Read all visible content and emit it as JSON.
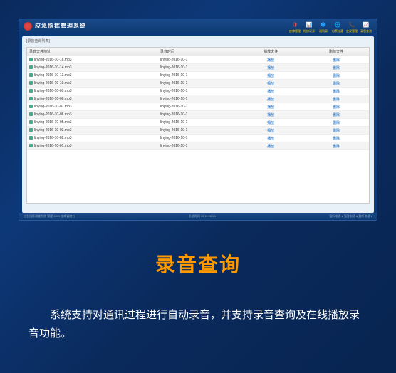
{
  "app": {
    "title": "应急指挥管理系统",
    "breadcrumb": "[录音查询列表]"
  },
  "header_icons": [
    {
      "name": "shield-icon",
      "glyph": "🛡",
      "label": "座席管理",
      "color": "#e55"
    },
    {
      "name": "bars-icon",
      "glyph": "📊",
      "label": "短信记录",
      "color": "#fc0"
    },
    {
      "name": "badge-icon",
      "glyph": "🔷",
      "label": "通讯录",
      "color": "#4ad"
    },
    {
      "name": "globe-icon",
      "glyph": "🌐",
      "label": "出警派遣",
      "color": "#3b8"
    },
    {
      "name": "phone-icon",
      "glyph": "📞",
      "label": "会议管理",
      "color": "#3c6"
    },
    {
      "name": "chart-icon",
      "glyph": "📈",
      "label": "录音查询",
      "color": "#fc0"
    }
  ],
  "table": {
    "headers": {
      "address": "录音文件地址",
      "time": "录音时间",
      "play": "播放文件",
      "delete": "删除文件"
    },
    "rows": [
      {
        "file": "linying-2016-10-16.mp3",
        "time": "linying-2016-10-1",
        "play": "播放",
        "delete": "删除"
      },
      {
        "file": "linying-2016-10-14.mp3",
        "time": "linying-2016-10-1",
        "play": "播放",
        "delete": "删除"
      },
      {
        "file": "linying-2016-10-13.mp3",
        "time": "linying-2016-10-1",
        "play": "播放",
        "delete": "删除"
      },
      {
        "file": "linying-2016-10-10.mp3",
        "time": "linying-2016-10-1",
        "play": "播放",
        "delete": "删除"
      },
      {
        "file": "linying-2016-10-09.mp3",
        "time": "linying-2016-10-1",
        "play": "播放",
        "delete": "删除"
      },
      {
        "file": "linying-2016-10-08.mp3",
        "time": "linying-2016-10-1",
        "play": "播放",
        "delete": "删除"
      },
      {
        "file": "linying-2016-10-07.mp3",
        "time": "linying-2016-10-1",
        "play": "播放",
        "delete": "删除"
      },
      {
        "file": "linying-2016-10-06.mp3",
        "time": "linying-2016-10-1",
        "play": "播放",
        "delete": "删除"
      },
      {
        "file": "linying-2016-10-05.mp3",
        "time": "linying-2016-10-1",
        "play": "播放",
        "delete": "删除"
      },
      {
        "file": "linying-2016-10-03.mp3",
        "time": "linying-2016-10-1",
        "play": "播放",
        "delete": "删除"
      },
      {
        "file": "linying-2016-10-02.mp3",
        "time": "linying-2016-10-1",
        "play": "播放",
        "delete": "删除"
      },
      {
        "file": "linying-2016-10-01.mp3",
        "time": "linying-2016-10-1",
        "play": "播放",
        "delete": "删除"
      }
    ]
  },
  "footer": {
    "left": "应急指挥调度系统  管理   1001  座席调度台",
    "center": "系统时间  15:11:50.04",
    "right": "强拆电话 ● 强答电话 ● 监听电话 ●"
  },
  "slide": {
    "title": "录音查询",
    "desc": "系统支持对通讯过程进行自动录音，并支持录音查询及在线播放录音功能。"
  }
}
